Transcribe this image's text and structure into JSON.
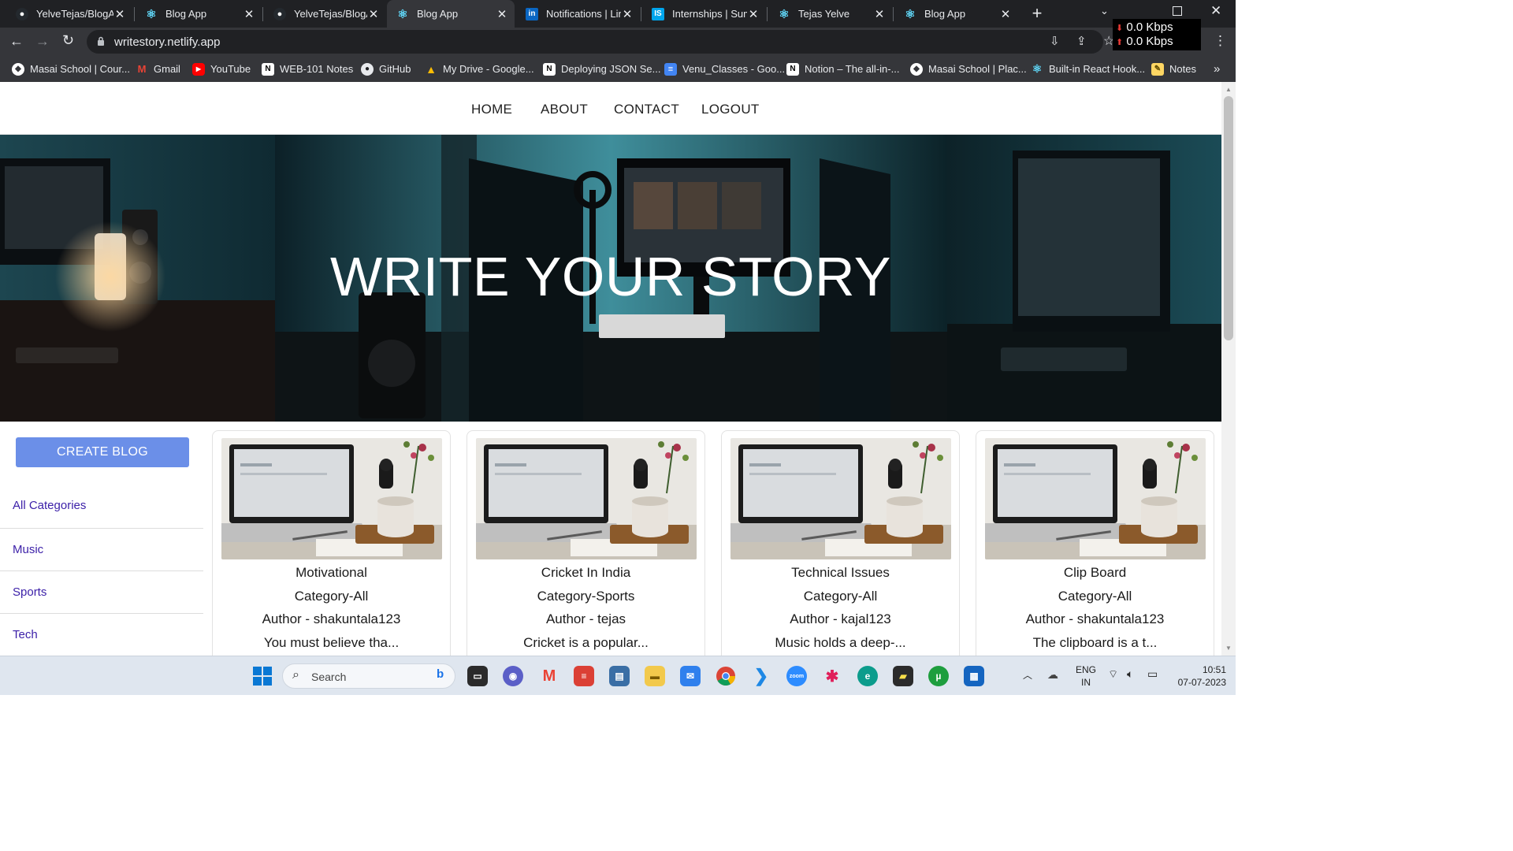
{
  "browser": {
    "tabs": [
      {
        "title": "YelveTejas/BlogAp",
        "icon": "github-icon",
        "color": "#24292e"
      },
      {
        "title": "Blog App",
        "icon": "react-icon",
        "color": "#61dafb"
      },
      {
        "title": "YelveTejas/BlogAp",
        "icon": "github-icon",
        "color": "#24292e"
      },
      {
        "title": "Blog App",
        "icon": "react-icon",
        "color": "#61dafb",
        "active": true
      },
      {
        "title": "Notifications | Lin",
        "icon": "linkedin-icon",
        "color": "#0a66c2"
      },
      {
        "title": "Internships | Sum",
        "icon": "internshala-icon",
        "color": "#00a5ec"
      },
      {
        "title": "Tejas Yelve",
        "icon": "react-icon",
        "color": "#61dafb"
      },
      {
        "title": "Blog App",
        "icon": "react-icon",
        "color": "#61dafb"
      }
    ],
    "url": "writestory.netlify.app",
    "net_speed_down": "0.0 Kbps",
    "net_speed_up": "0.0 Kbps",
    "bookmarks": [
      {
        "label": "Masai School | Cour...",
        "icon": "masai-icon"
      },
      {
        "label": "Gmail",
        "icon": "gmail-icon"
      },
      {
        "label": "YouTube",
        "icon": "youtube-icon"
      },
      {
        "label": "WEB-101 Notes",
        "icon": "notion-icon"
      },
      {
        "label": "GitHub",
        "icon": "github-icon"
      },
      {
        "label": "My Drive - Google...",
        "icon": "google-drive-icon"
      },
      {
        "label": "Deploying JSON Se...",
        "icon": "notion-icon"
      },
      {
        "label": "Venu_Classes - Goo...",
        "icon": "google-docs-icon"
      },
      {
        "label": "Notion – The all-in-...",
        "icon": "notion-icon"
      },
      {
        "label": "Masai School | Plac...",
        "icon": "masai-icon"
      },
      {
        "label": "Built-in React Hook...",
        "icon": "react-icon"
      },
      {
        "label": "Notes",
        "icon": "notes-icon"
      }
    ]
  },
  "nav": {
    "home": "HOME",
    "about": "ABOUT",
    "contact": "CONTACT",
    "logout": "LOGOUT"
  },
  "hero": {
    "title": "WRITE YOUR STORY"
  },
  "sidebar": {
    "create_label": "CREATE BLOG",
    "categories": [
      "All Categories",
      "Music",
      "Sports",
      "Tech"
    ]
  },
  "posts": [
    {
      "title": "Motivational",
      "category": "Category-All",
      "author": "Author - shakuntala123",
      "excerpt": "You must believe tha..."
    },
    {
      "title": "Cricket In India",
      "category": "Category-Sports",
      "author": "Author - tejas",
      "excerpt": "Cricket is a popular..."
    },
    {
      "title": "Technical Issues",
      "category": "Category-All",
      "author": "Author - kajal123",
      "excerpt": "Music holds a deep-..."
    },
    {
      "title": "Clip Board",
      "category": "Category-All",
      "author": "Author - shakuntala123",
      "excerpt": "The clipboard is a t..."
    }
  ],
  "taskbar": {
    "search_placeholder": "Search",
    "lang": "ENG",
    "region": "IN",
    "time": "10:51",
    "date": "07-07-2023"
  },
  "colors": {
    "accent_button": "#6b8fe8",
    "category_link": "#3b1fa8",
    "chrome_dark": "#202124",
    "chrome_toolbar": "#35363a"
  }
}
